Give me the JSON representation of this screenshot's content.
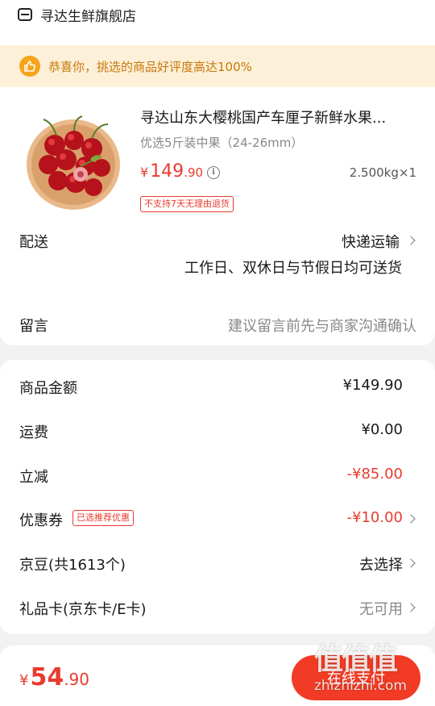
{
  "store": {
    "name": "寻达生鲜旗舰店",
    "icon": "store-icon"
  },
  "banner": {
    "text": "恭喜你，挑选的商品好评度高达100%",
    "icon": "thumbs-up-icon"
  },
  "product": {
    "title": "寻达山东大樱桃国产车厘子新鲜水果...",
    "spec": "优选5斤装中果（24-26mm）",
    "price_currency": "¥",
    "price_int": "149",
    "price_dec": ".90",
    "quantity": "2.500kg×1",
    "return_policy": "不支持7天无理由退货",
    "image": "cherries-bowl-image"
  },
  "delivery": {
    "label": "配送",
    "method": "快递运输",
    "note": "工作日、双休日与节假日均可送货"
  },
  "message": {
    "label": "留言",
    "placeholder": "建议留言前先与商家沟通确认"
  },
  "summary": {
    "goods_label": "商品金额",
    "goods_value": "¥149.90",
    "freight_label": "运费",
    "freight_value": "¥0.00",
    "discount_label": "立减",
    "discount_value": "-¥85.00",
    "coupon_label": "优惠券",
    "coupon_badge": "已选推荐优惠",
    "coupon_value": "-¥10.00",
    "jd_beans_label": "京豆(共1613个)",
    "jd_beans_value": "去选择",
    "gift_card_label": "礼品卡(京东卡/E卡)",
    "gift_card_value": "无可用"
  },
  "footer": {
    "total_currency": "¥",
    "total_int": "54",
    "total_dec": ".90",
    "pay_label": "在线支付"
  },
  "watermark": {
    "logo": "值值值",
    "site": "zhizhizhi.com"
  },
  "colors": {
    "accent": "#e93b2f",
    "banner_bg": "#fdf0d8",
    "banner_text": "#c8780a"
  }
}
